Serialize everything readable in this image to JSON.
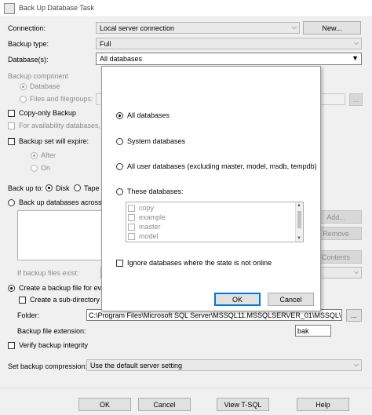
{
  "window": {
    "title": "Back Up Database Task"
  },
  "connection": {
    "label": "Connection:",
    "value": "Local server connection",
    "new_label": "New..."
  },
  "backup_type": {
    "label": "Backup type:",
    "value": "Full"
  },
  "databases": {
    "label": "Database(s):",
    "value": "All databases"
  },
  "backup_component": {
    "label": "Backup component",
    "database_label": "Database",
    "files_label": "Files and filegroups:",
    "browse_label": "..."
  },
  "copy_only": {
    "label": "Copy-only Backup"
  },
  "availability": {
    "label": "For availability databases, ig"
  },
  "expire": {
    "label": "Backup set will expire:",
    "after_label": "After",
    "on_label": "On"
  },
  "backup_to": {
    "label": "Back up to:",
    "disk_label": "Disk",
    "tape_label": "Tape"
  },
  "across": {
    "label": "Back up databases across on"
  },
  "side_buttons": {
    "add": "Add...",
    "remove": "Remove",
    "contents": "Contents"
  },
  "if_files_exist": {
    "label": "If backup files exist:"
  },
  "create_file": {
    "label": "Create a backup file for every"
  },
  "subdir": {
    "label": "Create a sub-directory fo"
  },
  "folder": {
    "label": "Folder:",
    "value": "C:\\Program Files\\Microsoft SQL Server\\MSSQL11.MSSQLSERVER_01\\MSSQL\\Backup",
    "browse_label": "..."
  },
  "extension": {
    "label": "Backup file extension:",
    "value": "bak"
  },
  "verify": {
    "label": "Verify backup integrity"
  },
  "compression": {
    "label": "Set backup compression:",
    "value": "Use the default server setting"
  },
  "footer": {
    "ok": "OK",
    "cancel": "Cancel",
    "view_tsql": "View T-SQL",
    "help": "Help"
  },
  "popup": {
    "options": [
      {
        "label": "All databases",
        "selected": true
      },
      {
        "label": "System databases",
        "selected": false
      },
      {
        "label": "All user databases  (excluding master, model, msdb, tempdb)",
        "selected": false
      },
      {
        "label": "These databases:",
        "selected": false
      }
    ],
    "list_items": [
      "copy",
      "example",
      "master",
      "model"
    ],
    "ignore_label": "Ignore databases where the state is not online",
    "ok": "OK",
    "cancel": "Cancel"
  }
}
